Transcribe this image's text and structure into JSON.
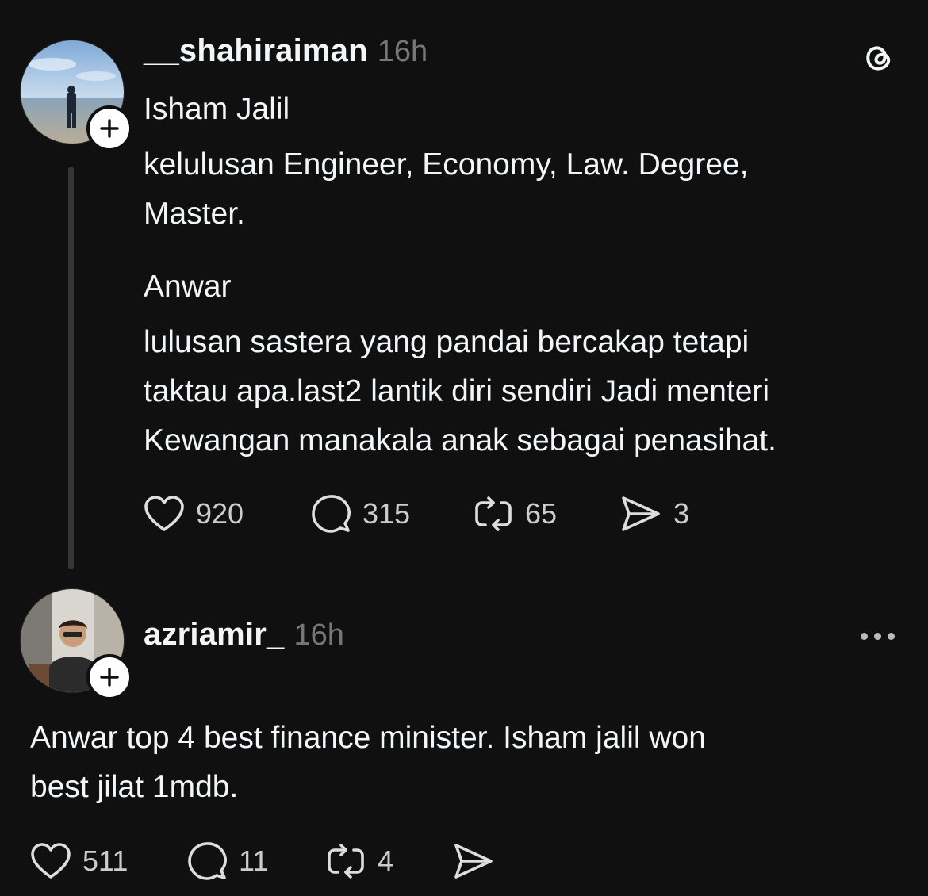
{
  "post1": {
    "username": "__shahiraiman",
    "time": "16h",
    "lines": [
      "Isham Jalil",
      "kelulusan Engineer, Economy, Law. Degree,",
      "Master.",
      "Anwar",
      "lulusan sastera yang pandai bercakap tetapi",
      "taktau apa.last2 lantik diri sendiri Jadi menteri",
      "Kewangan manakala anak sebagai penasihat."
    ],
    "likes": "920",
    "replies": "315",
    "reposts": "65",
    "shares": "3"
  },
  "post2": {
    "username": "azriamir_",
    "time": "16h",
    "lines": [
      "Anwar top 4 best finance minister. Isham jalil won",
      "best jilat 1mdb."
    ],
    "likes": "511",
    "replies": "11",
    "reposts": "4"
  },
  "icons": {
    "top_right": "threads-logo-icon",
    "more": "more-options-icon",
    "like": "heart-icon",
    "reply": "comment-icon",
    "repost": "repost-icon",
    "share": "send-icon",
    "follow": "plus-icon"
  },
  "colors": {
    "background": "#101010",
    "text": "#f3f5f7",
    "muted": "#777777",
    "thread_line": "#333638"
  }
}
